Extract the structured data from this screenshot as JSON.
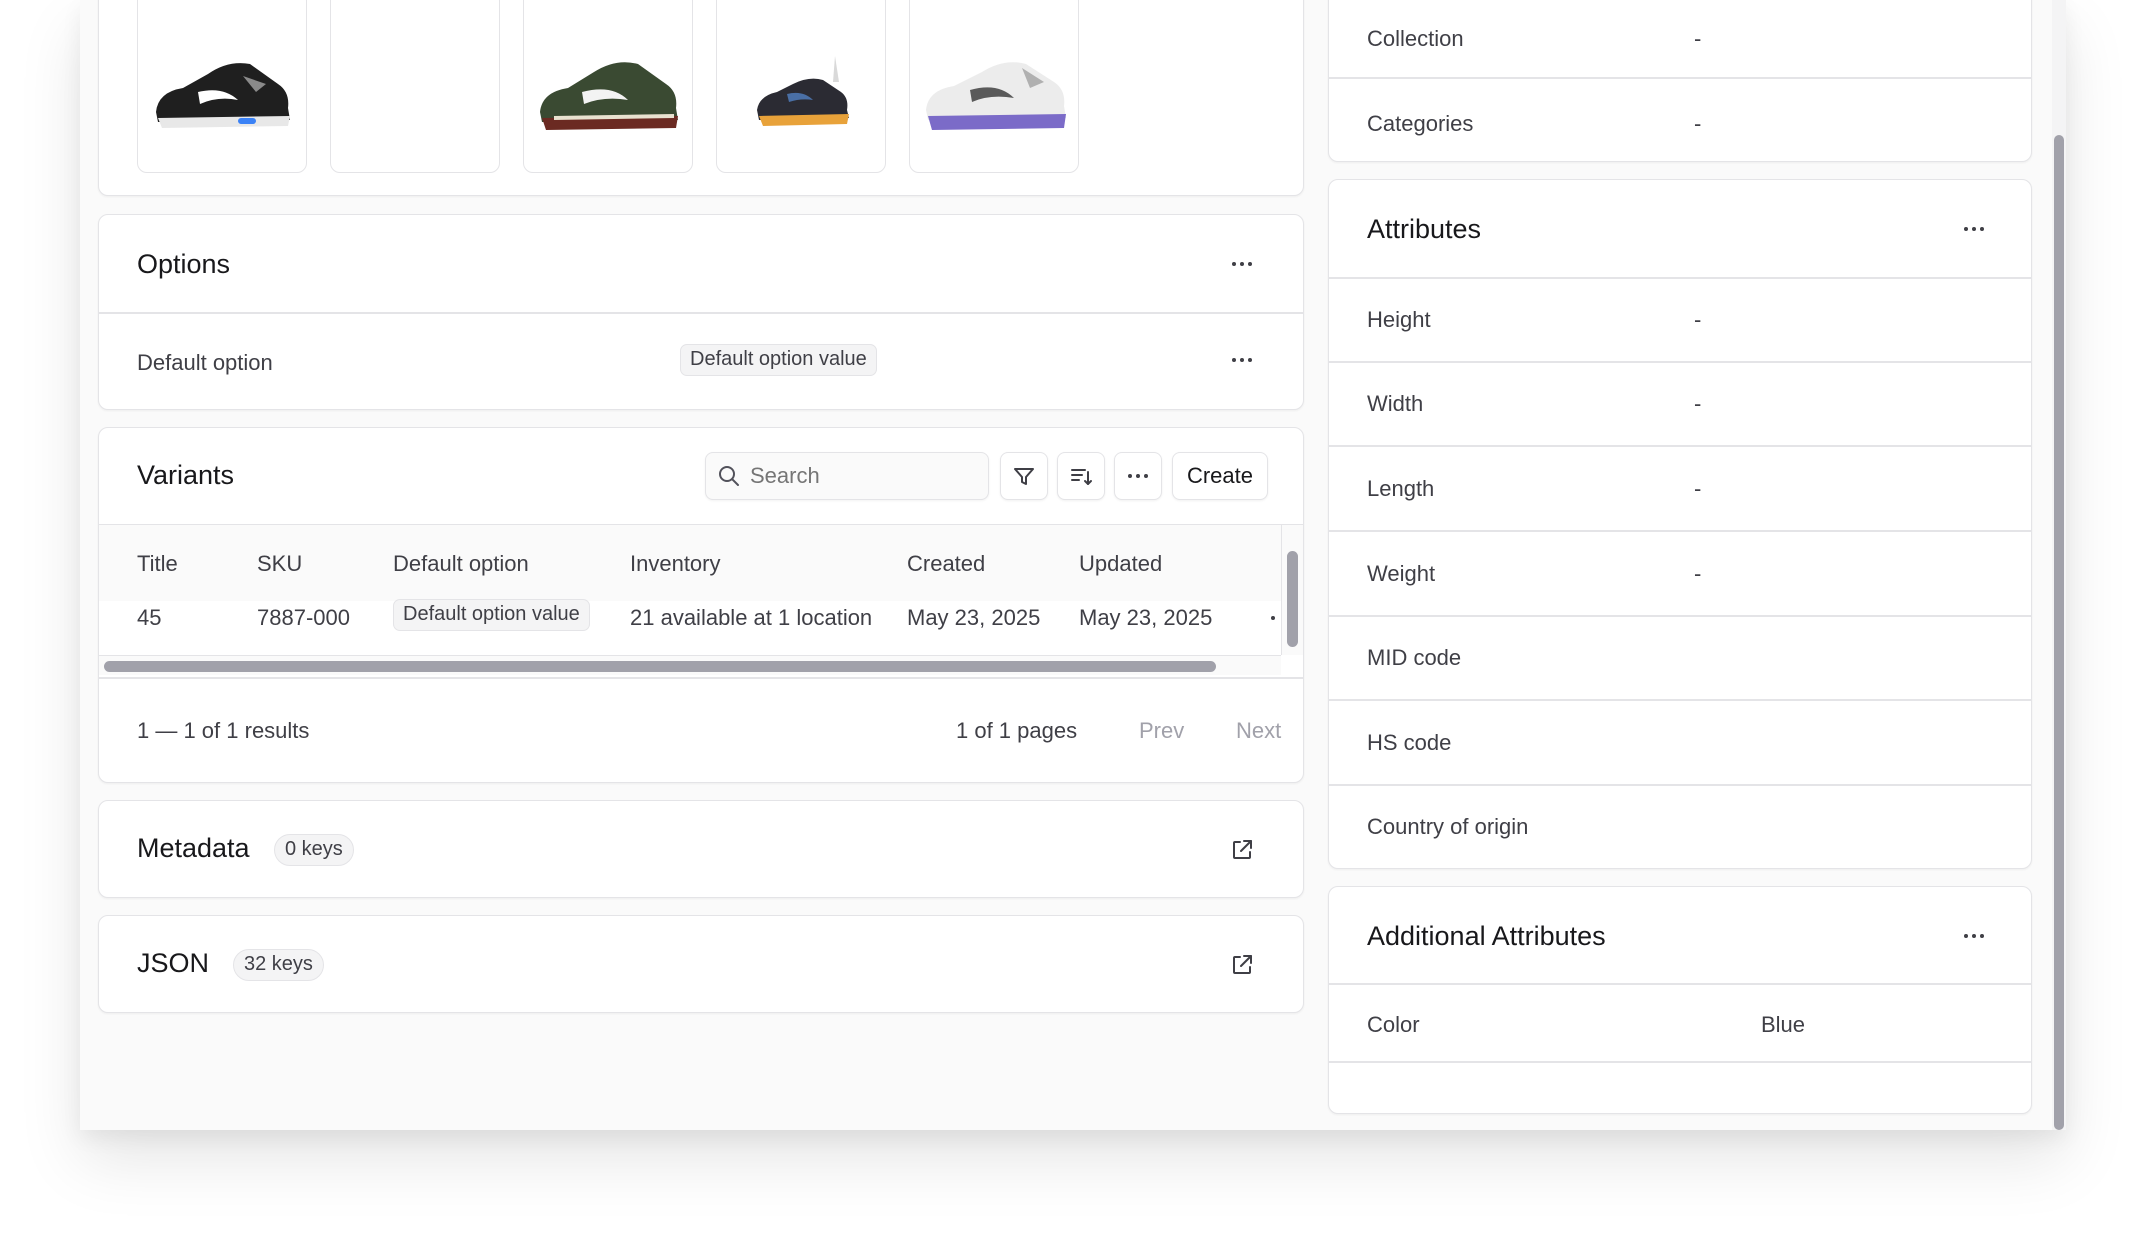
{
  "media": {
    "thumbnails": [
      {
        "name": "shoe-black-grey"
      },
      {
        "name": "empty"
      },
      {
        "name": "shoe-green-red"
      },
      {
        "name": "shoe-black-orange"
      },
      {
        "name": "shoe-white-purple"
      }
    ]
  },
  "options": {
    "title": "Options",
    "rows": [
      {
        "label": "Default option",
        "value": "Default option value"
      }
    ]
  },
  "variants": {
    "title": "Variants",
    "search_placeholder": "Search",
    "create_label": "Create",
    "columns": [
      "Title",
      "SKU",
      "Default option",
      "Inventory",
      "Created",
      "Updated"
    ],
    "rows": [
      {
        "title": "45",
        "sku": "7887-000",
        "option": "Default option value",
        "inventory": "21 available at 1 location",
        "created": "May 23, 2025",
        "updated": "May 23, 2025"
      }
    ],
    "results": "1 — 1 of 1 results",
    "pages": "1 of 1 pages",
    "prev": "Prev",
    "next": "Next"
  },
  "metadata": {
    "title": "Metadata",
    "badge": "0 keys"
  },
  "json": {
    "title": "JSON",
    "badge": "32 keys"
  },
  "organize": {
    "rows": [
      {
        "label": "Collection",
        "value": "-"
      },
      {
        "label": "Categories",
        "value": "-"
      }
    ]
  },
  "attributes": {
    "title": "Attributes",
    "rows": [
      {
        "label": "Height",
        "value": "-"
      },
      {
        "label": "Width",
        "value": "-"
      },
      {
        "label": "Length",
        "value": "-"
      },
      {
        "label": "Weight",
        "value": "-"
      },
      {
        "label": "MID code",
        "value": ""
      },
      {
        "label": "HS code",
        "value": ""
      },
      {
        "label": "Country of origin",
        "value": ""
      }
    ]
  },
  "additional_attributes": {
    "title": "Additional Attributes",
    "rows": [
      {
        "label": "Color",
        "value": "Blue"
      }
    ]
  },
  "colors": {
    "border": "#e4e4e7",
    "text": "#18181b",
    "muted": "#71717a",
    "tag_bg": "#f4f4f5"
  }
}
